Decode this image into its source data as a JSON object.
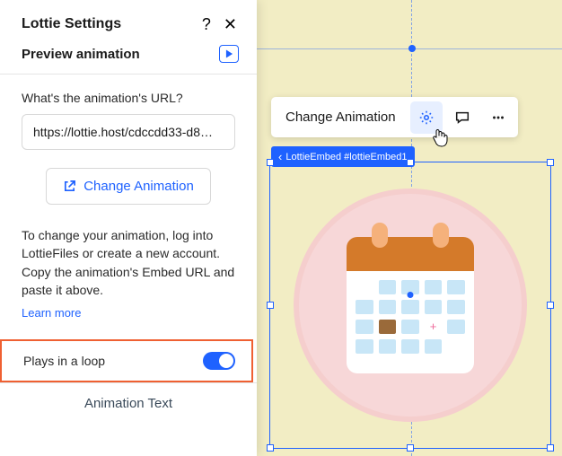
{
  "panel": {
    "title": "Lottie Settings",
    "preview_label": "Preview animation",
    "url_label": "What's the animation's URL?",
    "url_value": "https://lottie.host/cdccdd33-d8…",
    "change_label": "Change Animation",
    "info_text": "To change your animation, log into LottieFiles or create a new account. Copy the animation's Embed URL and paste it above.",
    "learn_more": "Learn more",
    "loop_label": "Plays in a loop",
    "footer_tab": "Animation Text"
  },
  "toolbar": {
    "change_animation": "Change Animation"
  },
  "embed_tag": "LottieEmbed #lottieEmbed1"
}
